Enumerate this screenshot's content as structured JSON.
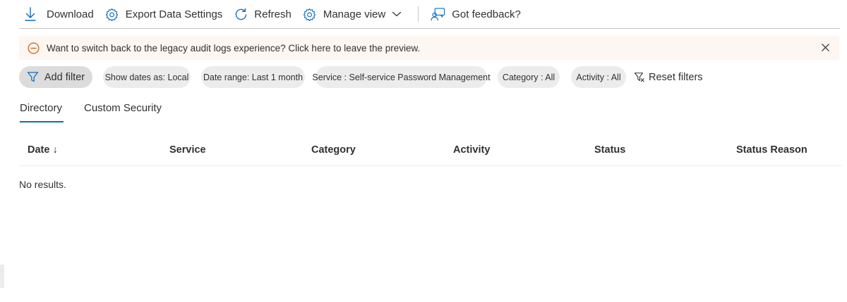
{
  "toolbar": {
    "download_label": "Download",
    "export_label": "Export Data Settings",
    "refresh_label": "Refresh",
    "manage_view_label": "Manage view",
    "feedback_label": "Got feedback?",
    "icons": [
      "download-icon",
      "gear-icon",
      "refresh-icon",
      "gear-icon",
      "chevron-down-icon",
      "feedback-icon"
    ]
  },
  "banner": {
    "text": "Want to switch back to the legacy audit logs experience? Click here to leave the preview.",
    "icons": [
      "warning-circle-icon",
      "close-icon"
    ]
  },
  "filters": {
    "add_filter_label": "Add filter",
    "pills": [
      "Show dates as: Local",
      "Date range: Last 1 month",
      "Service : Self-service Password Management",
      "Category : All",
      "Activity : All"
    ],
    "reset_label": "Reset filters",
    "icons": [
      "filter-icon",
      "clear-filter-icon"
    ]
  },
  "tabs": [
    {
      "label": "Directory",
      "active": true
    },
    {
      "label": "Custom Security",
      "active": false
    }
  ],
  "table": {
    "columns": [
      "Date",
      "Service",
      "Category",
      "Activity",
      "Status",
      "Status Reason"
    ],
    "sort_indicator": "↓",
    "empty_text": "No results."
  },
  "colors": {
    "accent": "#0f6cbd",
    "banner_bg": "#fdf6f1",
    "warning": "#c4621c",
    "pill_bg": "#ececec"
  }
}
